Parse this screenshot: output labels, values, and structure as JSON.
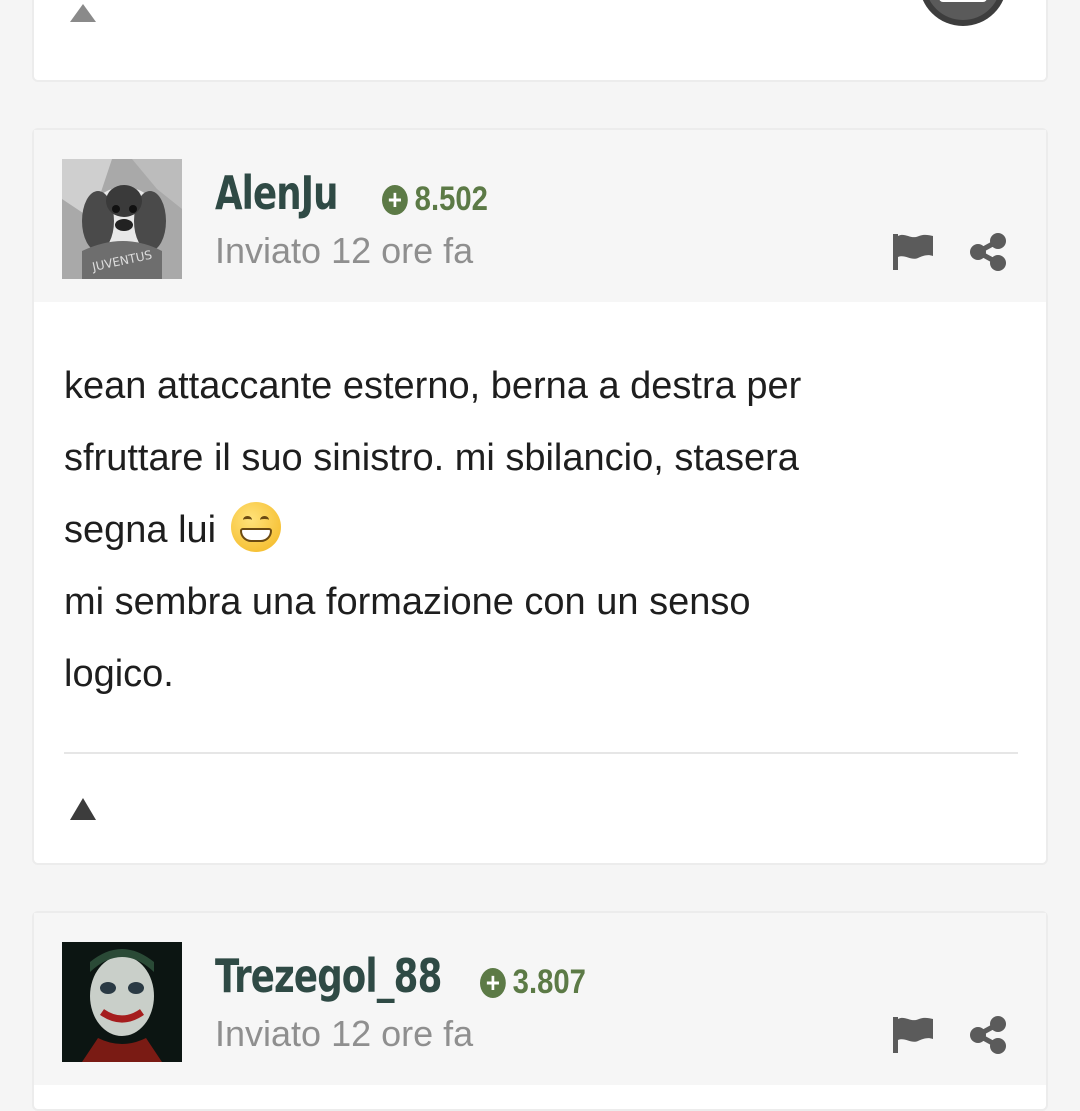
{
  "posts": [
    {
      "username": "AlenJu",
      "reputation": "8.502",
      "posted": "Inviato 12 ore fa",
      "avatar_caption": "JUVENTUS",
      "body_lines": [
        "kean attaccante esterno, berna a destra per",
        "sfruttare il suo sinistro. mi sbilancio, stasera",
        "segna lui",
        "mi sembra una formazione con un senso",
        "logico."
      ],
      "emoji": "grinning-face-emoji"
    },
    {
      "username": "Trezegol_88",
      "reputation": "3.807",
      "posted": "Inviato 12 ore fa"
    }
  ],
  "icons": {
    "report": "flag-icon",
    "share": "share-icon",
    "upvote": "upvote-arrow-icon",
    "reputation": "plus-circle-icon",
    "reaction_badge": "thumbs-up-badge-icon"
  },
  "colors": {
    "username": "#2f4a45",
    "reputation": "#5c7a46",
    "meta": "#8f8f8f",
    "header_bg": "#f6f6f6",
    "page_bg": "#f5f5f5"
  }
}
